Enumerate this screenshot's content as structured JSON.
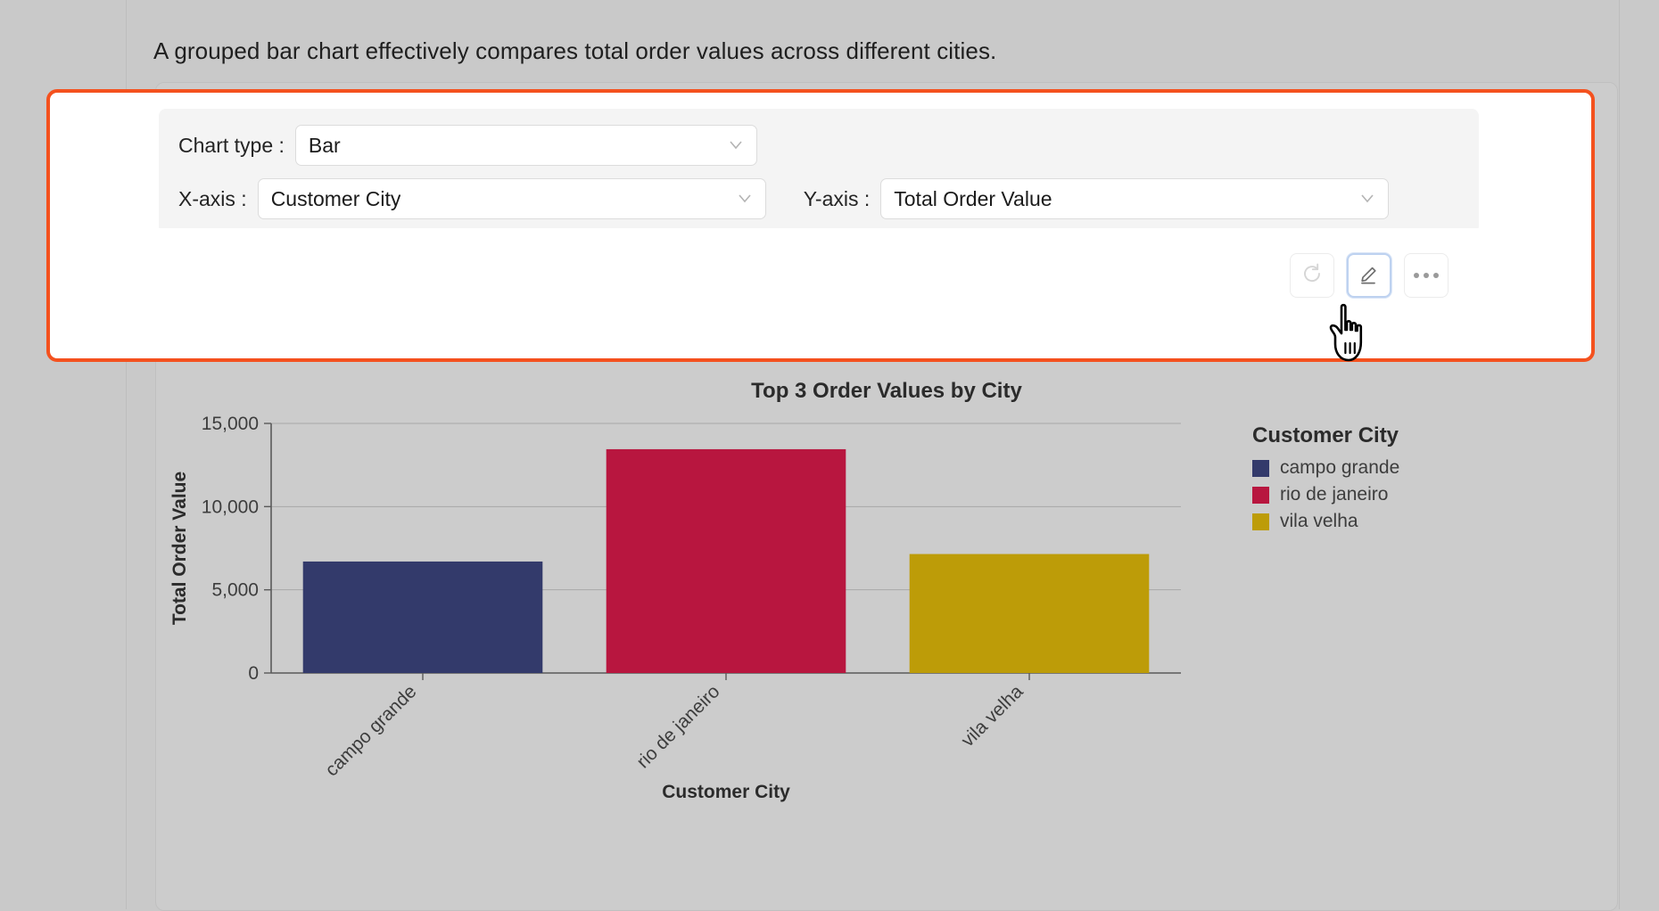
{
  "headline": "A grouped bar chart effectively compares total order values across different cities.",
  "controls": {
    "chart_type": {
      "label": "Chart type :",
      "value": "Bar",
      "chevron_icon": "chevron-down-icon"
    },
    "x_axis": {
      "label": "X-axis :",
      "value": "Customer City",
      "chevron_icon": "chevron-down-icon"
    },
    "y_axis": {
      "label": "Y-axis :",
      "value": "Total Order Value",
      "chevron_icon": "chevron-down-icon"
    }
  },
  "toolbar": {
    "refresh_icon": "refresh-icon",
    "edit_icon": "pencil-edit-icon",
    "more_icon": "more-options-icon"
  },
  "cursor": {
    "icon": "hand-pointer-cursor"
  },
  "legend": {
    "title": "Customer City",
    "items": [
      {
        "label": "campo grande",
        "color": "#333a6b"
      },
      {
        "label": "rio de janeiro",
        "color": "#b8163f"
      },
      {
        "label": "vila velha",
        "color": "#bd9c08"
      }
    ]
  },
  "chart_data": {
    "type": "bar",
    "title": "Top 3 Order Values by City",
    "xlabel": "Customer City",
    "ylabel": "Total Order Value",
    "categories": [
      "campo grande",
      "rio de janeiro",
      "vila velha"
    ],
    "values": [
      6700,
      13450,
      7150
    ],
    "colors": [
      "#333a6b",
      "#b8163f",
      "#bd9c08"
    ],
    "ylim": [
      0,
      15000
    ],
    "yticks": [
      0,
      5000,
      10000,
      15000
    ],
    "ytick_labels": [
      "0",
      "5,000",
      "10,000",
      "15,000"
    ],
    "grid": true,
    "legend_position": "right",
    "xtick_rotation": -45
  },
  "colors": {
    "highlight_border": "#f4511e",
    "page_background": "#c9c9c9",
    "panel_background": "#f4f4f4"
  }
}
